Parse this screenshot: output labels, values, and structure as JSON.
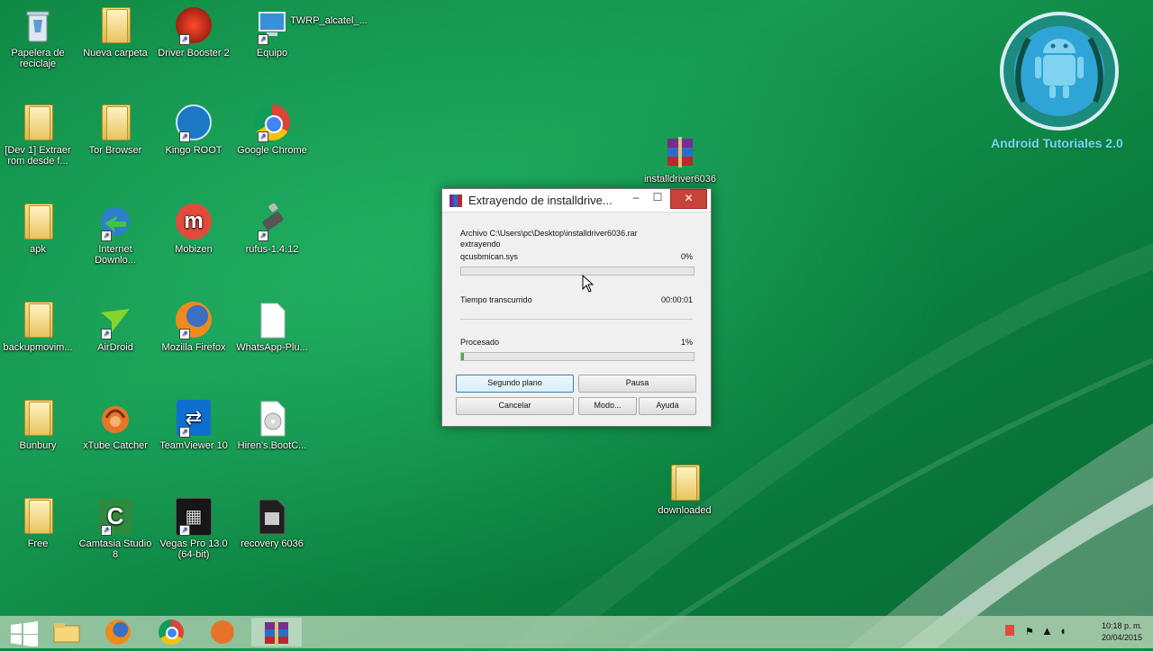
{
  "desktop": {
    "icons": [
      {
        "label": "Papelera de reciclaje",
        "icon": "recycle-bin-icon"
      },
      {
        "label": "Nueva carpeta",
        "icon": "folder-icon"
      },
      {
        "label": "Driver Booster 2",
        "icon": "driver-booster-icon"
      },
      {
        "label": "Equipo",
        "icon": "computer-icon"
      },
      {
        "label": "TWRP_alcatel_...",
        "icon": "file-icon"
      },
      {
        "label": "[Dev 1] Extraer rom desde f...",
        "icon": "folder-icon"
      },
      {
        "label": "Tor Browser",
        "icon": "folder-icon"
      },
      {
        "label": "Kingo ROOT",
        "icon": "kingo-root-icon"
      },
      {
        "label": "Google Chrome",
        "icon": "chrome-icon"
      },
      {
        "label": "apk",
        "icon": "folder-icon"
      },
      {
        "label": "Internet Downlo...",
        "icon": "internet-download-manager-icon"
      },
      {
        "label": "Mobizen",
        "icon": "mobizen-icon"
      },
      {
        "label": "rufus-1.4.12",
        "icon": "rufus-icon"
      },
      {
        "label": "backupmovim...",
        "icon": "folder-icon"
      },
      {
        "label": "AirDroid",
        "icon": "airdroid-icon"
      },
      {
        "label": "Mozilla Firefox",
        "icon": "firefox-icon"
      },
      {
        "label": "WhatsApp-Plu...",
        "icon": "file-icon"
      },
      {
        "label": "Bunbury",
        "icon": "folder-icon"
      },
      {
        "label": "xTube Catcher",
        "icon": "xtube-catcher-icon"
      },
      {
        "label": "TeamViewer 10",
        "icon": "teamviewer-icon"
      },
      {
        "label": "Hiren's.BootC...",
        "icon": "disc-image-icon"
      },
      {
        "label": "Free",
        "icon": "folder-icon"
      },
      {
        "label": "Camtasia Studio 8",
        "icon": "camtasia-icon"
      },
      {
        "label": "Vegas Pro 13.0 (64-bit)",
        "icon": "vegas-pro-icon"
      },
      {
        "label": "recovery 6036",
        "icon": "film-icon"
      },
      {
        "label": "installdriver6036",
        "icon": "winrar-archive-icon"
      },
      {
        "label": "downloaded",
        "icon": "folder-icon"
      }
    ]
  },
  "branding": {
    "text": "Android Tutoriales 2.0",
    "color": "#7fd3f0"
  },
  "dialog": {
    "title": "Extrayendo de installdrive...",
    "archive_line": "Archivo C:\\Users\\pc\\Desktop\\installdriver6036.rar",
    "action_line": "extrayendo",
    "current_file": "qcusbmican.sys",
    "current_percent": "0%",
    "current_progress": 0,
    "elapsed_label": "Tiempo transcurrido",
    "elapsed_value": "00:00:01",
    "processed_label": "Procesado",
    "processed_percent": "1%",
    "processed_progress": 0.01,
    "buttons": {
      "background": "Segundo plano",
      "pause": "Pausa",
      "cancel": "Cancelar",
      "mode": "Modo...",
      "help": "Ayuda"
    }
  },
  "taskbar": {
    "items": [
      {
        "icon": "start-windows-icon"
      },
      {
        "icon": "file-explorer-icon"
      },
      {
        "icon": "firefox-icon"
      },
      {
        "icon": "chrome-icon"
      },
      {
        "icon": "xtube-catcher-icon"
      },
      {
        "icon": "winrar-icon"
      }
    ],
    "clock_time": "10:18 p. m.",
    "clock_date": "20/04/2015"
  }
}
